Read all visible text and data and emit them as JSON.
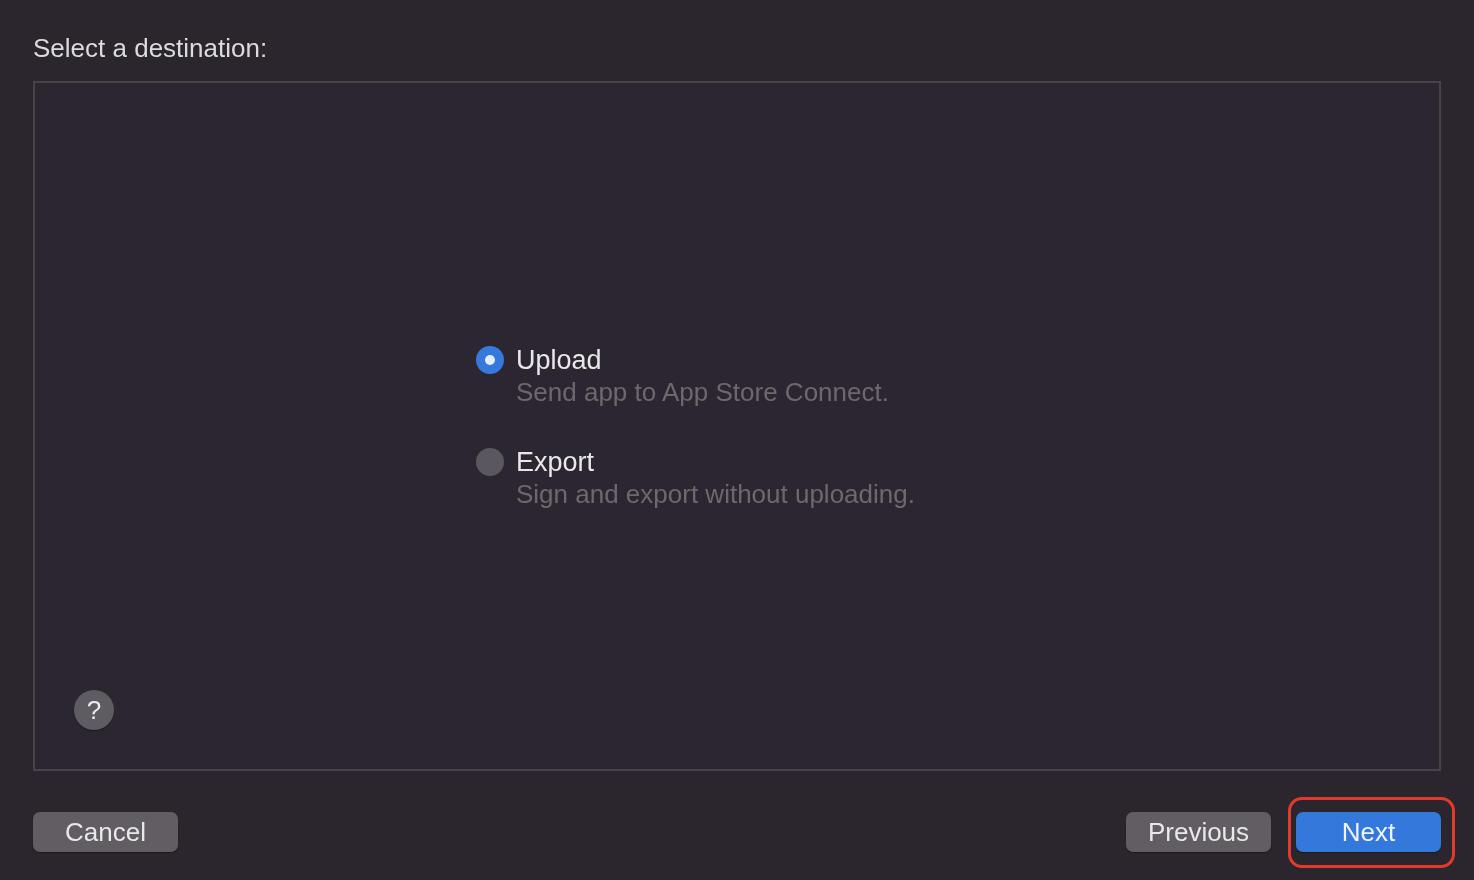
{
  "dialog": {
    "title": "Select a destination:"
  },
  "options": [
    {
      "label": "Upload",
      "description": "Send app to App Store Connect.",
      "selected": true
    },
    {
      "label": "Export",
      "description": "Sign and export without uploading.",
      "selected": false
    }
  ],
  "help_button": {
    "label": "?"
  },
  "footer": {
    "left_buttons": [
      {
        "label": "Cancel",
        "kind": "secondary",
        "highlighted": false
      }
    ],
    "right_buttons": [
      {
        "label": "Previous",
        "kind": "secondary",
        "highlighted": false
      },
      {
        "label": "Next",
        "kind": "primary",
        "highlighted": true
      }
    ]
  }
}
